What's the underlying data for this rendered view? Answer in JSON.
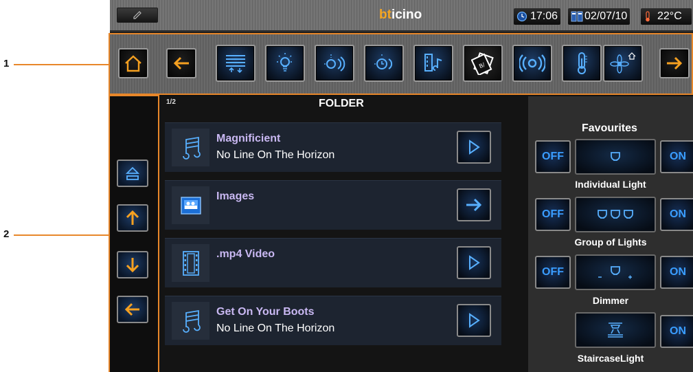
{
  "callouts": [
    {
      "label": "1"
    },
    {
      "label": "2"
    }
  ],
  "status_bar": {
    "brand_prefix": "bt",
    "brand_suffix": "icino",
    "time": "17:06",
    "date": "02/07/10",
    "temperature": "22°C",
    "icons": [
      "pen-icon",
      "clock-icon",
      "calendar-icon",
      "thermometer-icon"
    ]
  },
  "toolbar": {
    "buttons": [
      {
        "icon": "home-icon"
      },
      {
        "icon": "back-arrow-icon"
      },
      {
        "icon": "shutters-icon"
      },
      {
        "icon": "light-bulb-icon"
      },
      {
        "icon": "light-scene-icon"
      },
      {
        "icon": "light-timer-icon"
      },
      {
        "icon": "film-music-icon"
      },
      {
        "icon": "multimedia-cards-icon",
        "active": true
      },
      {
        "icon": "sound-broadcast-icon"
      },
      {
        "icon": "thermometer-icon"
      },
      {
        "icon": "flower-home-icon"
      },
      {
        "icon": "forward-arrow-icon"
      }
    ]
  },
  "nav": {
    "buttons": [
      {
        "icon": "eject-icon"
      },
      {
        "icon": "up-arrow-icon"
      },
      {
        "icon": "down-arrow-icon"
      },
      {
        "icon": "back-arrow-icon"
      }
    ]
  },
  "folder": {
    "page_indicator": "1/2",
    "title": "FOLDER",
    "items": [
      {
        "title": "Magnificient",
        "subtitle": "No Line On The Horizon",
        "icon": "music-note-icon",
        "action": "play-icon"
      },
      {
        "title": "Images",
        "subtitle": "",
        "icon": "image-icon",
        "action": "forward-arrow-icon"
      },
      {
        "title": ".mp4 Video",
        "subtitle": "",
        "icon": "film-icon",
        "action": "play-icon"
      },
      {
        "title": "Get On Your Boots",
        "subtitle": "No Line On The Horizon",
        "icon": "music-note-icon",
        "action": "play-icon"
      }
    ]
  },
  "favourites": {
    "title": "Favourites",
    "off_label": "OFF",
    "on_label": "ON",
    "items": [
      {
        "label": "Individual Light",
        "icon": "single-lamp-icon",
        "has_off": true
      },
      {
        "label": "Group of Lights",
        "icon": "lamp-group-icon",
        "has_off": true
      },
      {
        "label": "Dimmer",
        "icon": "dimmer-icon",
        "has_off": true
      },
      {
        "label": "StaircaseLight",
        "icon": "staircase-light-icon",
        "has_off": false
      }
    ]
  },
  "colors": {
    "accent_orange": "#e8872a",
    "accent_blue": "#3a9dff",
    "item_title": "#c9b8f2"
  }
}
